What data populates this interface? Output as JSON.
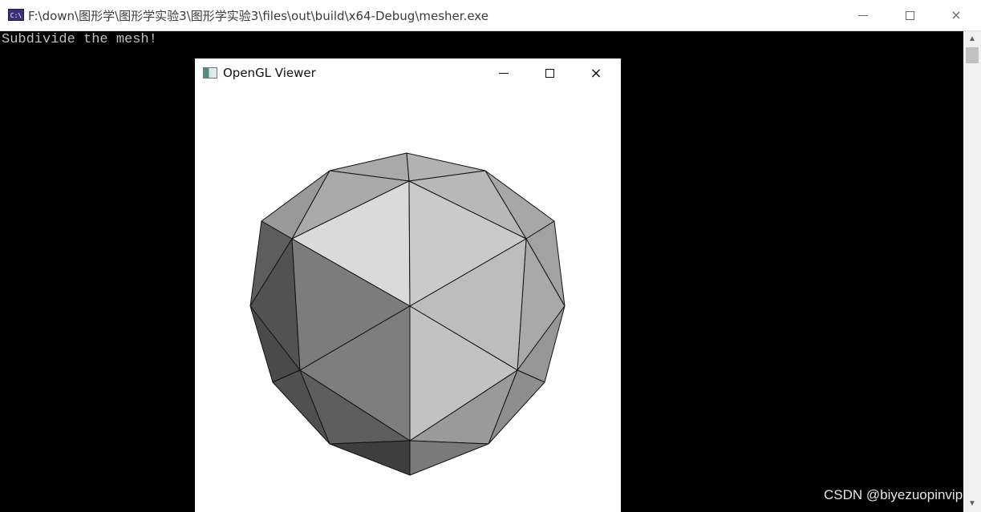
{
  "console": {
    "title": "F:\\down\\图形学\\图形学实验3\\图形学实验3\\files\\out\\build\\x64-Debug\\mesher.exe",
    "icon_text": "C:\\",
    "output": "Subdivide the mesh!",
    "controls": {
      "minimize": "minimize-icon",
      "maximize": "maximize-icon",
      "close": "×"
    }
  },
  "gl_window": {
    "title": "OpenGL Viewer",
    "controls": {
      "minimize": "minimize-icon",
      "maximize": "maximize-icon",
      "close": "×"
    }
  },
  "scrollbar": {
    "up": "▲",
    "down": "▼"
  },
  "watermark": "CSDN @biyezuopinvip",
  "colors": {
    "console_bg": "#000000",
    "console_text": "#c0c0c0",
    "titlebar": "#ffffff",
    "viewport_bg": "#ffffff"
  }
}
